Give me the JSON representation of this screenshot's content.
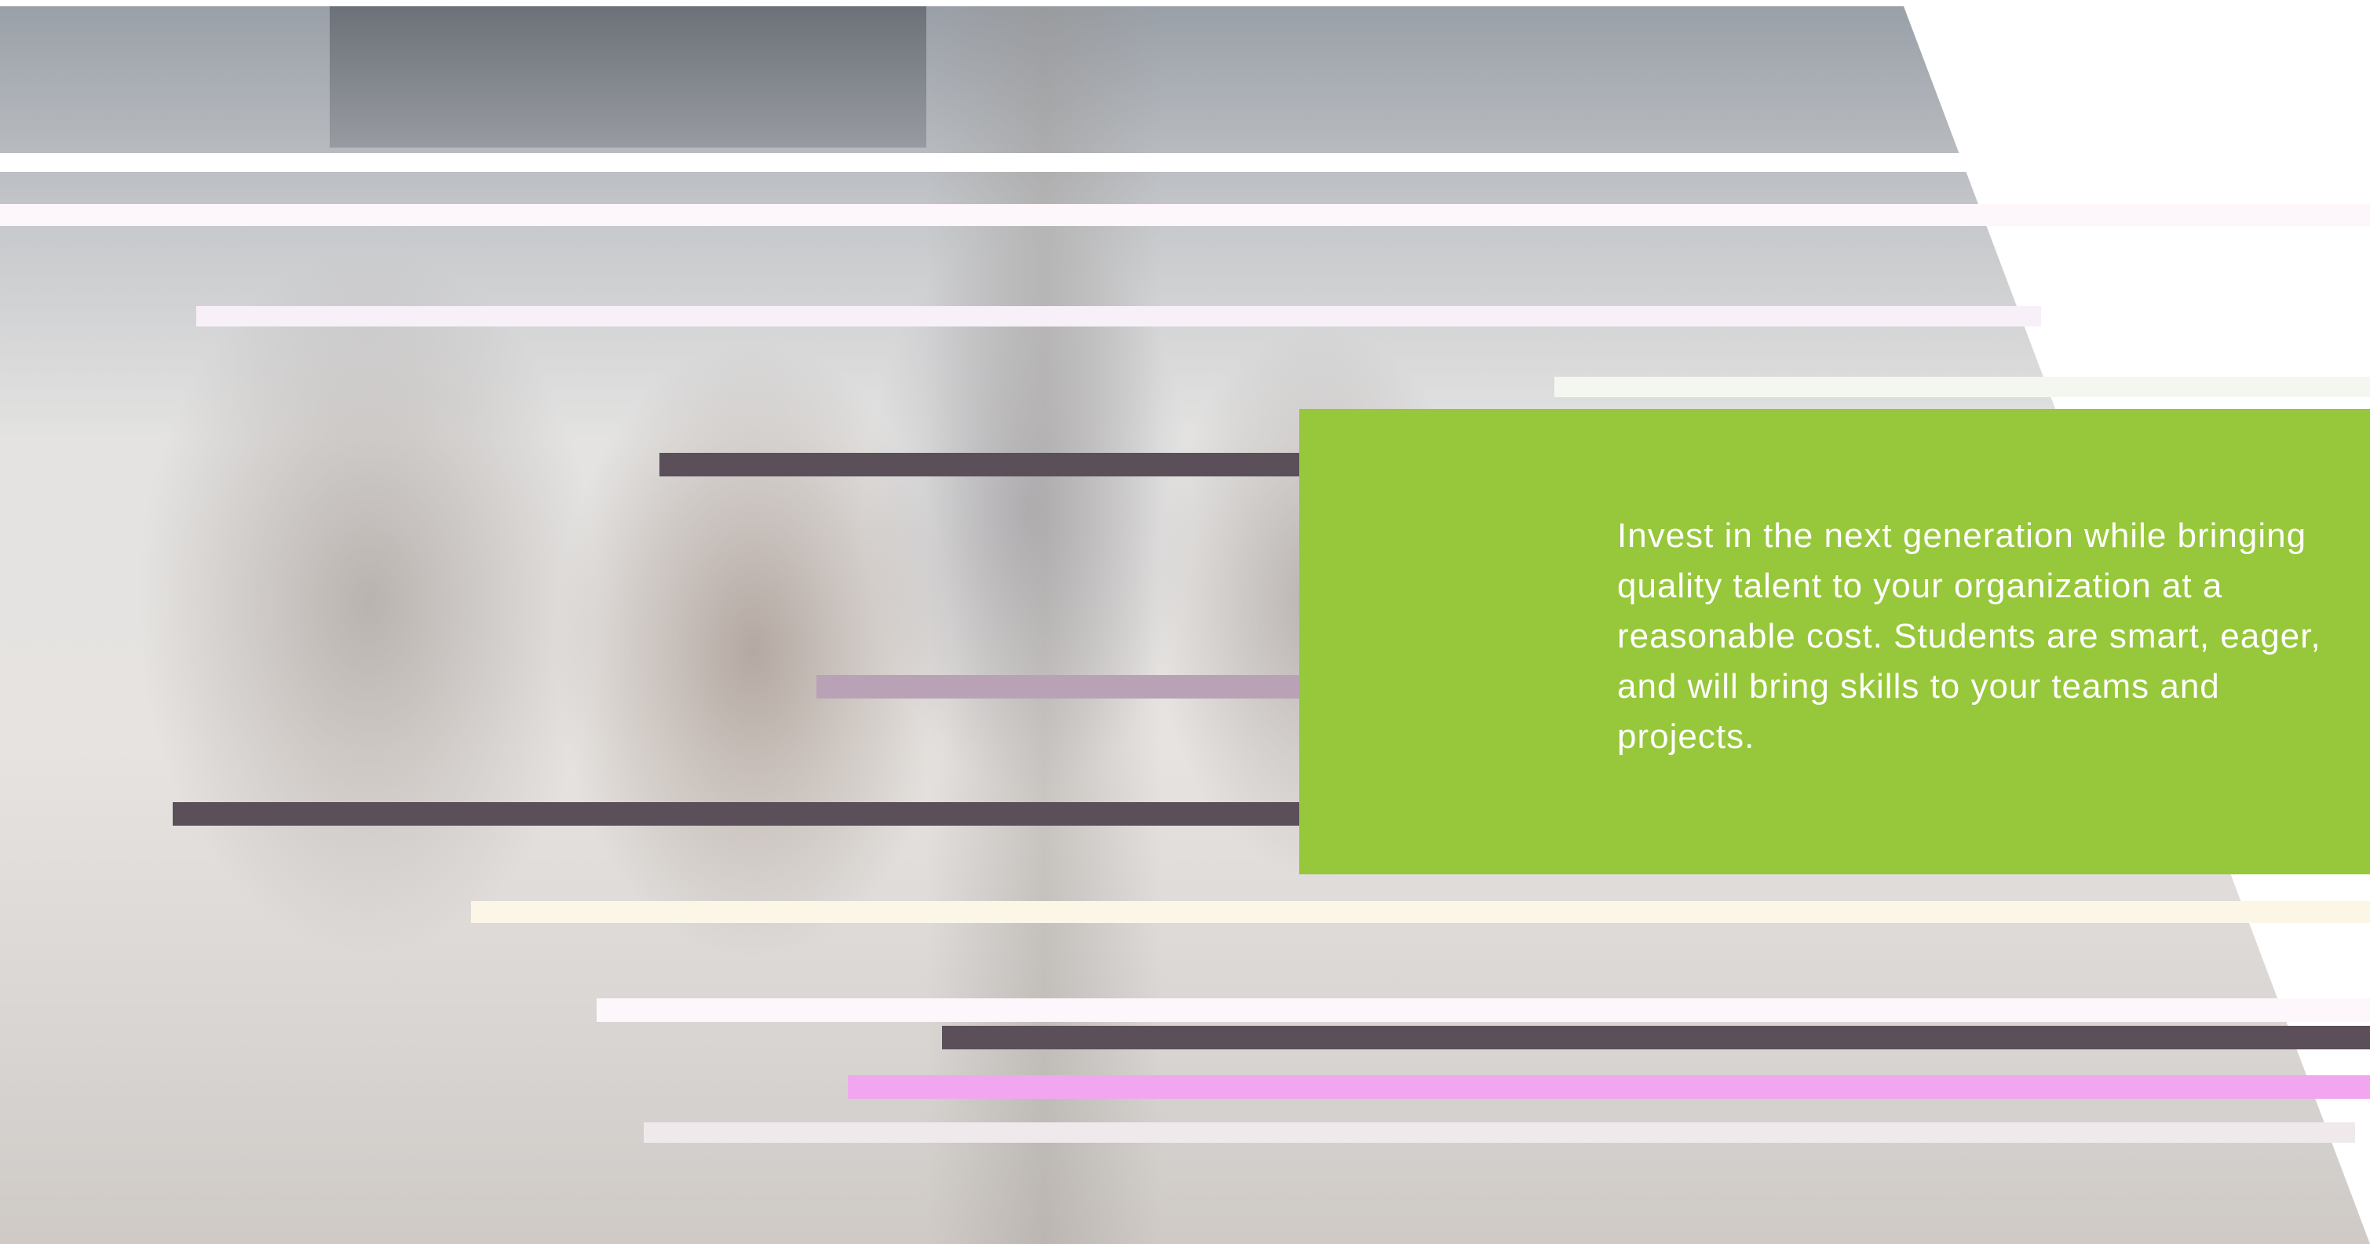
{
  "hero": {
    "image_description_name": "team-photo",
    "overlay_colors": {
      "panel": "#97c73a",
      "text": "#ffffff"
    }
  },
  "callout": {
    "body": "Invest in the next generation while bringing quality talent to your organization at a reasonable cost. Students are smart, eager, and will bring skills to your teams and projects."
  }
}
